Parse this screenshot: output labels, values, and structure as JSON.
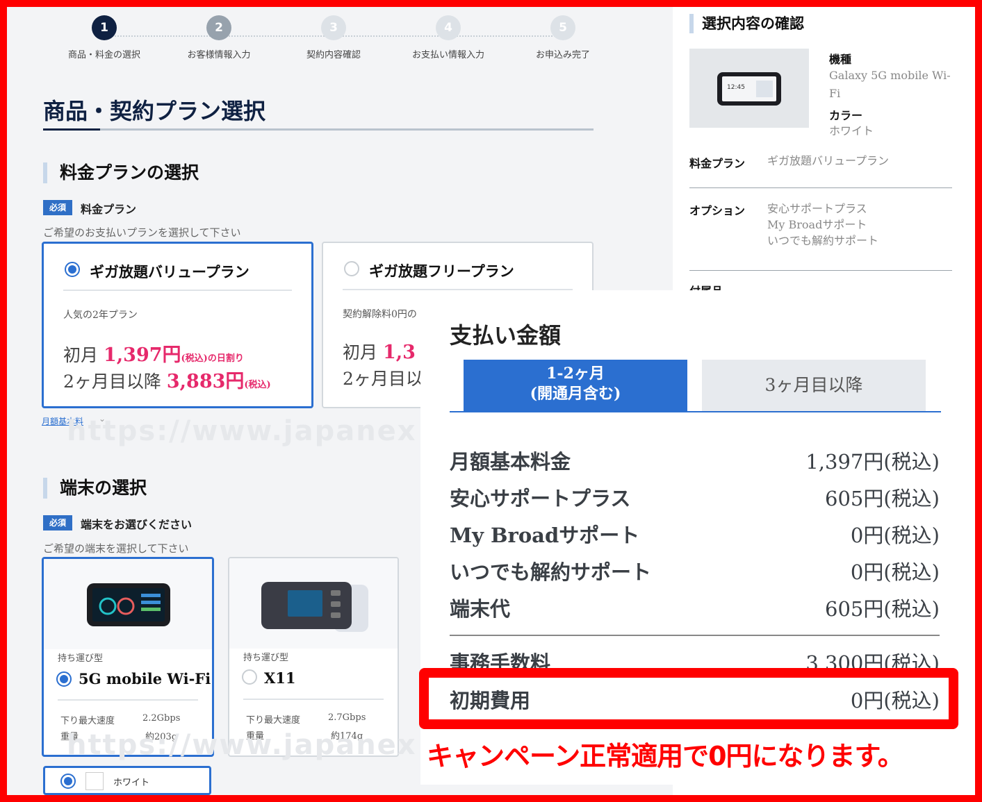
{
  "stepper": {
    "steps": [
      {
        "num": "1",
        "label": "商品・料金の選択"
      },
      {
        "num": "2",
        "label": "お客様情報入力"
      },
      {
        "num": "3",
        "label": "契約内容確認"
      },
      {
        "num": "4",
        "label": "お支払い情報入力"
      },
      {
        "num": "5",
        "label": "お申込み完了"
      }
    ]
  },
  "page_title": "商品・契約プラン選択",
  "plan_section": {
    "heading": "料金プランの選択",
    "required_badge": "必須",
    "label": "料金プラン",
    "hint": "ご希望のお支払いプランを選択して下さい",
    "plans": [
      {
        "name": "ギガ放題バリュープラン",
        "selected": true,
        "desc": "人気の2年プラン",
        "first_month": "初月",
        "first_price": "1,397円",
        "first_suffix": "(税込)の日割り",
        "later": "2ヶ月目以降",
        "later_price": "3,883円",
        "later_suffix": "(税込)"
      },
      {
        "name": "ギガ放題フリープラン",
        "selected": false,
        "desc": "契約解除料0円の",
        "first_month": "初月",
        "first_price": "1,3",
        "later": "2ヶ月目以"
      }
    ],
    "link": "月額基本料",
    "link_chevron": "⌄"
  },
  "watermark": "https://www.japanex",
  "device_section": {
    "heading": "端末の選択",
    "required_badge": "必須",
    "label": "端末をお選びください",
    "hint": "ご希望の端末を選択して下さい",
    "devices": [
      {
        "type": "持ち運び型",
        "name": "5G mobile Wi-Fi",
        "selected": true,
        "spec_speed_label": "下り最大速度",
        "spec_speed": "2.2Gbps",
        "spec_weight_label": "重量",
        "spec_weight": "約203g"
      },
      {
        "type": "持ち運び型",
        "name": "X11",
        "selected": false,
        "spec_speed_label": "下り最大速度",
        "spec_speed": "2.7Gbps",
        "spec_weight_label": "重量",
        "spec_weight": "約174g"
      }
    ],
    "color": "ホワイト"
  },
  "confirm_panel": {
    "heading": "選択内容の確認",
    "model_key": "機種",
    "model_val": "Galaxy 5G mobile Wi-Fi",
    "color_key": "カラー",
    "color_val": "ホワイト",
    "plan_key": "料金プラン",
    "plan_val": "ギガ放題バリュープラン",
    "option_key": "オプション",
    "options": [
      "安心サポートプラス",
      "My Broadサポート",
      "いつでも解約サポート"
    ],
    "accessory_key": "付属品",
    "device_screen_time": "12:45"
  },
  "payment_popup": {
    "title": "支払い金額",
    "tab_active_line1": "1-2ヶ月",
    "tab_active_line2": "(開通月含む)",
    "tab_inactive": "3ヶ月目以降",
    "rows": [
      {
        "label": "月額基本料金",
        "value": "1,397円(税込)"
      },
      {
        "label": "安心サポートプラス",
        "value": "605円(税込)"
      },
      {
        "label": "My Broadサポート",
        "value": "0円(税込)"
      },
      {
        "label": "いつでも解約サポート",
        "value": "0円(税込)"
      },
      {
        "label": "端末代",
        "value": "605円(税込)"
      }
    ],
    "fees": [
      {
        "label": "事務手数料",
        "value": "3,300円(税込)"
      },
      {
        "label": "初期費用",
        "value": "0円(税込)"
      }
    ]
  },
  "annotation": "キャンペーン正常適用で0円になります。",
  "colors": {
    "accent": "#2b6fd0",
    "price": "#e6296b",
    "highlight": "#ff0000",
    "navy": "#0f2142"
  }
}
